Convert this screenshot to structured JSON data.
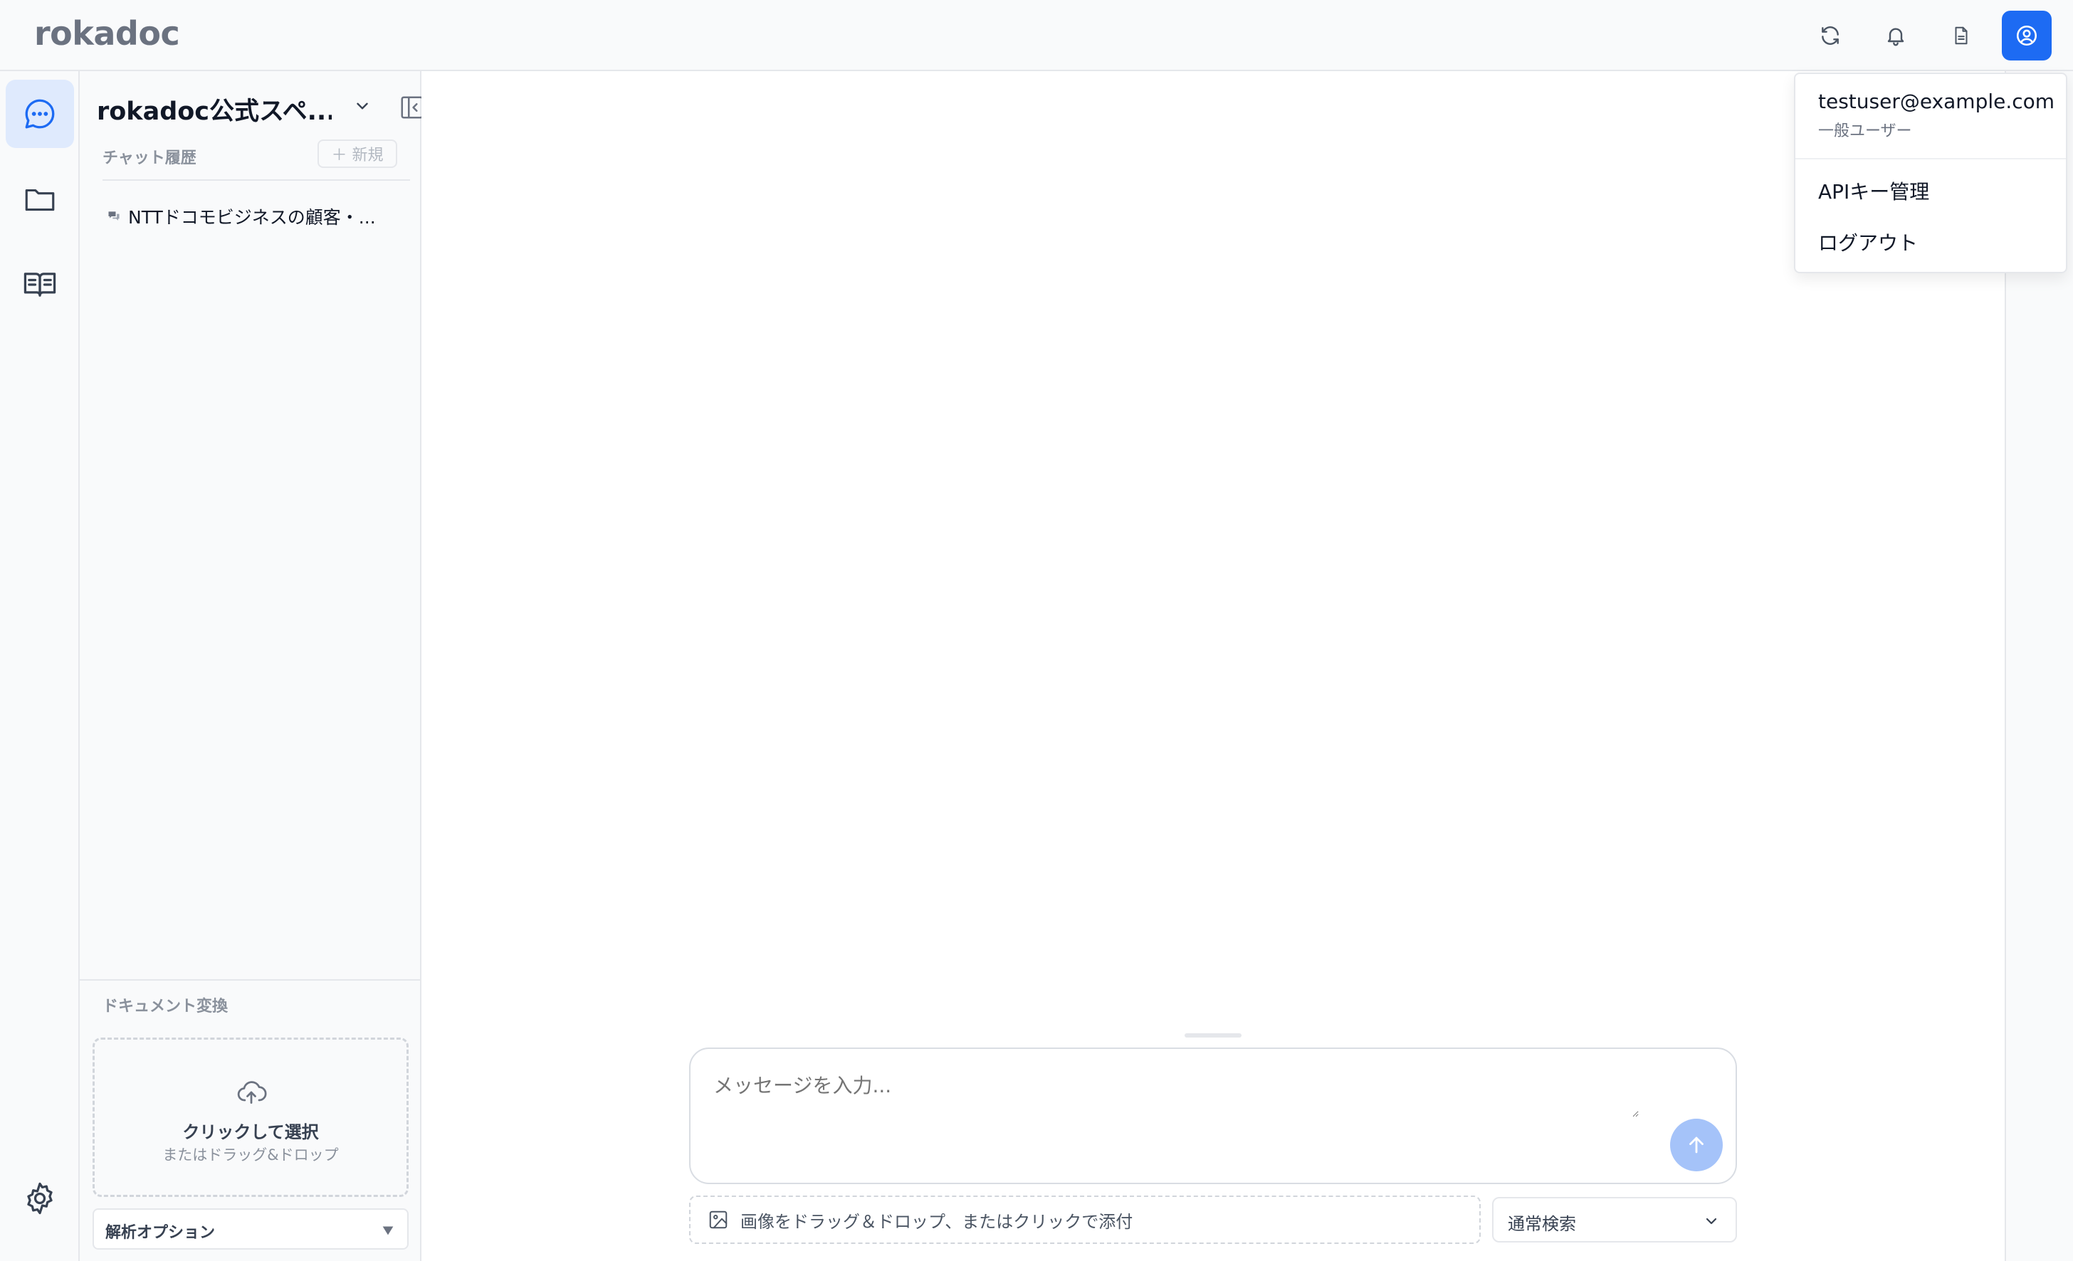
{
  "header": {
    "brand": "rokadoc",
    "accent_color": "#1d6bf3",
    "actions": [
      {
        "name": "refresh",
        "icon": "refresh-icon"
      },
      {
        "name": "notifications",
        "icon": "bell-icon"
      },
      {
        "name": "documents",
        "icon": "document-icon"
      },
      {
        "name": "user-menu",
        "icon": "user-circle-icon"
      }
    ]
  },
  "rail": {
    "items": [
      {
        "name": "chat",
        "icon": "chat-bubble-icon",
        "active": true
      },
      {
        "name": "files",
        "icon": "folder-icon"
      },
      {
        "name": "knowledge",
        "icon": "book-icon"
      },
      {
        "name": "settings",
        "icon": "gear-icon"
      }
    ]
  },
  "sidebar": {
    "workspace_name": "rokadoc公式スペ...",
    "history_label": "チャット履歴",
    "new_label": "＋ 新規",
    "chats": [
      {
        "title": "NTTドコモビジネスの顧客・..."
      }
    ],
    "doc_convert": {
      "label": "ドキュメント変換",
      "upload_title": "クリックして選択",
      "upload_subtitle": "またはドラッグ&ドロップ",
      "options_label": "解析オプション"
    }
  },
  "composer": {
    "placeholder": "メッセージを入力...",
    "attach_text": "画像をドラッグ＆ドロップ、またはクリックで添付",
    "search_mode": "通常検索"
  },
  "user_menu": {
    "email": "testuser@example.com",
    "role": "一般ユーザー",
    "items": [
      {
        "label": "APIキー管理"
      },
      {
        "label": "ログアウト"
      }
    ]
  }
}
